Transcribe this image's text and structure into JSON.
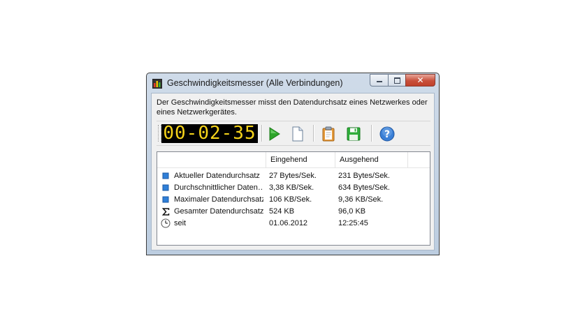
{
  "window": {
    "title": "Geschwindigkeitsmesser (Alle Verbindungen)",
    "close_glyph": "✕",
    "accent_close": "#c8503b"
  },
  "description": "Der Geschwindigkeitsmesser misst den Datendurchsatz eines Netzwerkes oder eines Netzwerkgerätes.",
  "timer": {
    "display": "00-02-35",
    "color": "#f4d21a"
  },
  "toolbar": {
    "buttons": [
      {
        "icon": "play-icon"
      },
      {
        "icon": "new-document-icon"
      },
      {
        "icon": "clipboard-icon"
      },
      {
        "icon": "save-icon"
      },
      {
        "icon": "help-icon"
      }
    ]
  },
  "table": {
    "columns": [
      "",
      "Eingehend",
      "Ausgehend"
    ],
    "rows": [
      {
        "icon": "blue-square-icon",
        "label": "Aktueller Datendurchsatz",
        "in": "27 Bytes/Sek.",
        "out": "231 Bytes/Sek."
      },
      {
        "icon": "blue-square-icon",
        "label": "Durchschnittlicher Daten…",
        "in": "3,38 KB/Sek.",
        "out": "634 Bytes/Sek."
      },
      {
        "icon": "blue-square-icon",
        "label": "Maximaler Datendurchsatz",
        "in": "106 KB/Sek.",
        "out": "9,36 KB/Sek."
      },
      {
        "icon": "sigma-icon",
        "label": "Gesamter Datendurchsatz",
        "in": "524 KB",
        "out": "96,0 KB"
      },
      {
        "icon": "clock-icon",
        "label": "seit",
        "in": "01.06.2012",
        "out": "12:25:45"
      }
    ]
  }
}
